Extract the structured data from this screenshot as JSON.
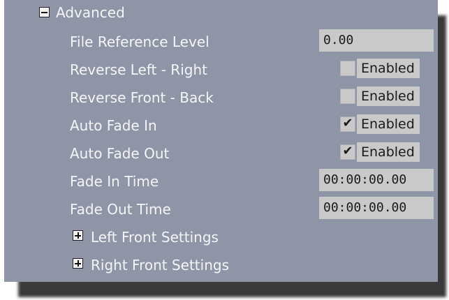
{
  "advanced": {
    "label": "Advanced",
    "toggle_icon": "collapse-minus-icon",
    "rows": {
      "file_reference_level": {
        "label": "File Reference Level",
        "value": "0.00"
      },
      "reverse_left_right": {
        "label": "Reverse Left - Right",
        "checked": false,
        "option_label": "Enabled"
      },
      "reverse_front_back": {
        "label": "Reverse Front - Back",
        "checked": false,
        "option_label": "Enabled"
      },
      "auto_fade_in": {
        "label": "Auto Fade In",
        "checked": true,
        "option_label": "Enabled"
      },
      "auto_fade_out": {
        "label": "Auto Fade Out",
        "checked": true,
        "option_label": "Enabled"
      },
      "fade_in_time": {
        "label": "Fade In Time",
        "value": "00:00:00.00"
      },
      "fade_out_time": {
        "label": "Fade Out Time",
        "value": "00:00:00.00"
      }
    },
    "subgroups": {
      "left_front": {
        "label": "Left Front Settings",
        "toggle_icon": "expand-plus-icon"
      },
      "right_front": {
        "label": "Right Front Settings",
        "toggle_icon": "expand-plus-icon"
      }
    }
  },
  "check_glyph": "✔"
}
